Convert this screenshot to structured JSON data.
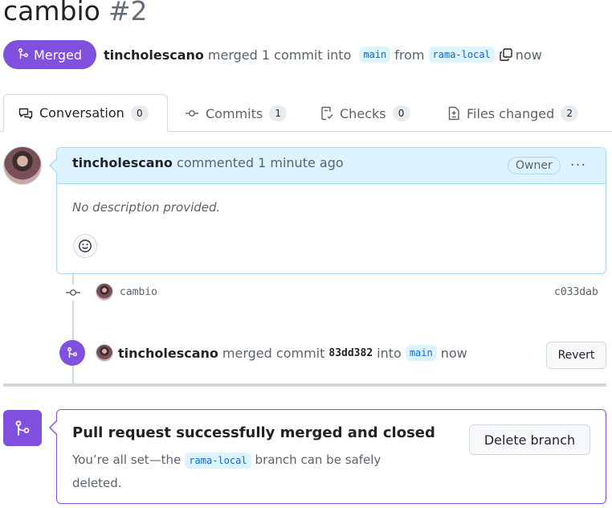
{
  "pr": {
    "title": "cambio",
    "number": "#2",
    "state_label": "Merged",
    "author": "tincholescano",
    "merge_text_1": "merged 1 commit into",
    "base_branch": "main",
    "merge_text_2": "from",
    "head_branch": "rama-local",
    "time": "now"
  },
  "tabs": [
    {
      "label": "Conversation",
      "count": "0"
    },
    {
      "label": "Commits",
      "count": "1"
    },
    {
      "label": "Checks",
      "count": "0"
    },
    {
      "label": "Files changed",
      "count": "2"
    }
  ],
  "comment": {
    "author": "tincholescano",
    "action": "commented 1 minute ago",
    "badge": "Owner",
    "more": "···",
    "body": "No description provided."
  },
  "timeline": {
    "commit_message": "cambio",
    "commit_sha": "c033dab",
    "merge_event": {
      "author": "tincholescano",
      "text_1": "merged commit",
      "sha": "83dd382",
      "text_2": "into",
      "branch": "main",
      "time": "now",
      "revert_label": "Revert"
    }
  },
  "merge_box": {
    "title": "Pull request successfully merged and closed",
    "desc_1": "You’re all set—the",
    "branch": "rama-local",
    "desc_2": "branch can be safely deleted.",
    "delete_label": "Delete branch"
  },
  "colors": {
    "merged": "#8250df",
    "link": "#0969da",
    "branch_bg": "#ddf4ff",
    "border": "#d1d9e0"
  }
}
